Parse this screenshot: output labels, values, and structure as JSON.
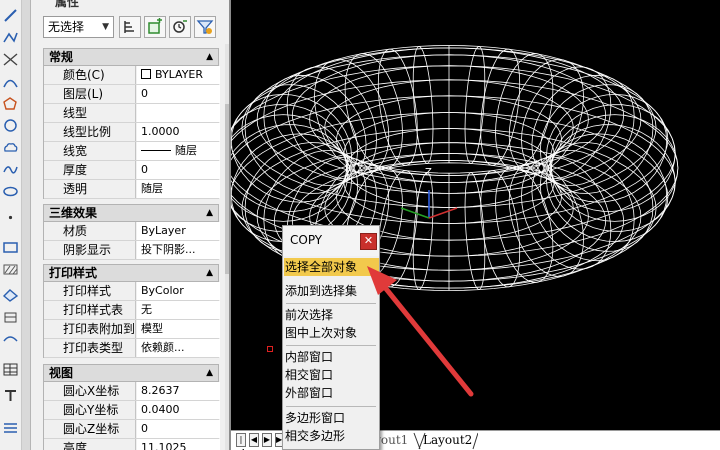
{
  "palette": {
    "title": "属性",
    "selector_value": "无选择",
    "buttons": [
      "toggle-pickadd",
      "select-objects",
      "quick-select",
      "filter"
    ],
    "sections": [
      {
        "title": "常规",
        "rows": [
          {
            "label": "颜色(C)",
            "value": "BYLAYER"
          },
          {
            "label": "图层(L)",
            "value": "0"
          },
          {
            "label": "线型",
            "value": ""
          },
          {
            "label": "线型比例",
            "value": "1.0000"
          },
          {
            "label": "线宽",
            "value": "随层"
          },
          {
            "label": "厚度",
            "value": "0"
          },
          {
            "label": "透明",
            "value": "随层"
          }
        ]
      },
      {
        "title": "三维效果",
        "rows": [
          {
            "label": "材质",
            "value": "ByLayer"
          },
          {
            "label": "阴影显示",
            "value": "投下阴影..."
          }
        ]
      },
      {
        "title": "打印样式",
        "rows": [
          {
            "label": "打印样式",
            "value": "ByColor"
          },
          {
            "label": "打印样式表",
            "value": "无"
          },
          {
            "label": "打印表附加到",
            "value": "模型"
          },
          {
            "label": "打印表类型",
            "value": "依赖颜..."
          }
        ]
      },
      {
        "title": "视图",
        "rows": [
          {
            "label": "圆心X坐标",
            "value": "8.2637"
          },
          {
            "label": "圆心Y坐标",
            "value": "0.0400"
          },
          {
            "label": "圆心Z坐标",
            "value": "0"
          },
          {
            "label": "高度",
            "value": "11.1025"
          }
        ]
      }
    ]
  },
  "canvas": {
    "axis_label": "Z",
    "background": "#000000",
    "wire_color": "#ffffff"
  },
  "context_menu": {
    "title": "COPY",
    "close_icon": "close-icon",
    "highlight_color": "#f2c94c",
    "items": [
      "选择全部对象",
      "添加到选择集",
      "前次选择",
      "图中上次对象",
      "内部窗口",
      "相交窗口",
      "外部窗口",
      "多边形窗口",
      "相交多边形"
    ]
  },
  "tabs": {
    "layouts": [
      "Layout1",
      "Layout2"
    ]
  },
  "annotation": {
    "arrow_color": "#e03a3a"
  },
  "toolbar": {
    "icons": [
      "line-icon",
      "polyline-icon",
      "construction-line-icon",
      "arc-icon",
      "polygon-icon",
      "rectangle-icon",
      "circle-icon",
      "revision-cloud-icon",
      "spline-icon",
      "ellipse-icon",
      "ellipse-arc-icon",
      "point-icon",
      "block-icon",
      "hatch-icon",
      "region-icon",
      "table-icon",
      "text-icon"
    ]
  }
}
